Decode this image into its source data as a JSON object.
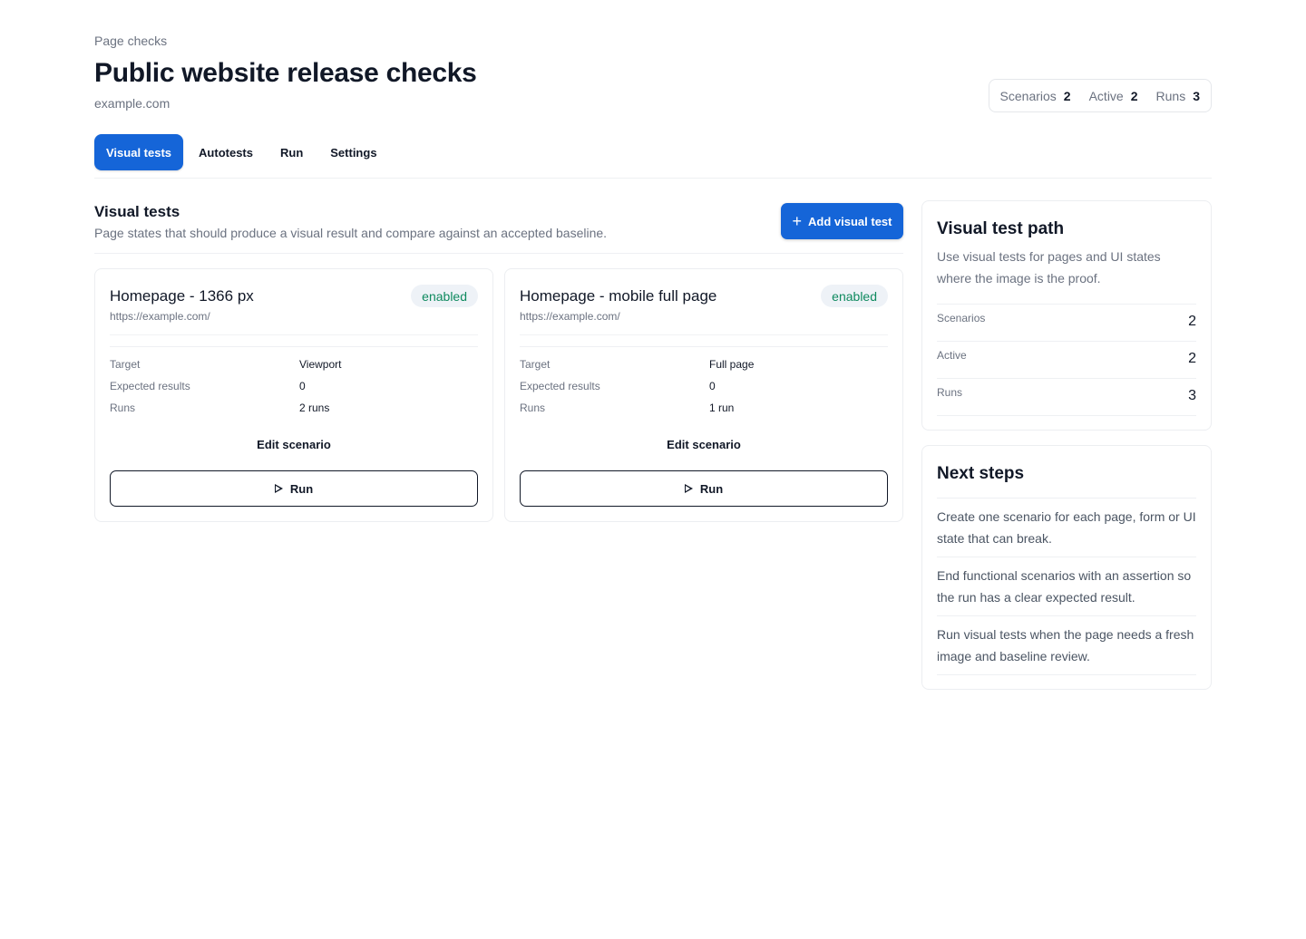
{
  "header": {
    "breadcrumb": "Page checks",
    "title": "Public website release checks",
    "domain": "example.com"
  },
  "summary": [
    {
      "label": "Scenarios",
      "value": "2"
    },
    {
      "label": "Active",
      "value": "2"
    },
    {
      "label": "Runs",
      "value": "3"
    }
  ],
  "tabs": [
    {
      "label": "Visual tests",
      "active": true
    },
    {
      "label": "Autotests",
      "active": false
    },
    {
      "label": "Run",
      "active": false
    },
    {
      "label": "Settings",
      "active": false
    }
  ],
  "section": {
    "title": "Visual tests",
    "description": "Page states that should produce a visual result and compare against an accepted baseline.",
    "add_button": "Add visual test"
  },
  "cards": [
    {
      "title": "Homepage - 1366 px",
      "url": "https://example.com/",
      "status": "enabled",
      "fields": [
        {
          "key": "Target",
          "value": "Viewport"
        },
        {
          "key": "Expected results",
          "value": "0"
        },
        {
          "key": "Runs",
          "value": "2 runs"
        }
      ],
      "edit_label": "Edit scenario",
      "run_label": "Run"
    },
    {
      "title": "Homepage - mobile full page",
      "url": "https://example.com/",
      "status": "enabled",
      "fields": [
        {
          "key": "Target",
          "value": "Full page"
        },
        {
          "key": "Expected results",
          "value": "0"
        },
        {
          "key": "Runs",
          "value": "1 run"
        }
      ],
      "edit_label": "Edit scenario",
      "run_label": "Run"
    }
  ],
  "path_panel": {
    "title": "Visual test path",
    "description": "Use visual tests for pages and UI states where the image is the proof.",
    "rows": [
      {
        "label": "Scenarios",
        "value": "2"
      },
      {
        "label": "Active",
        "value": "2"
      },
      {
        "label": "Runs",
        "value": "3"
      }
    ]
  },
  "next_steps": {
    "title": "Next steps",
    "items": [
      "Create one scenario for each page, form or UI state that can break.",
      "End functional scenarios with an assertion so the run has a clear expected result.",
      "Run visual tests when the page needs a fresh image and baseline review."
    ]
  },
  "colors": {
    "accent": "#1565d8",
    "status_enabled": "#0f8a5f",
    "badge_bg": "#eef2f7"
  }
}
